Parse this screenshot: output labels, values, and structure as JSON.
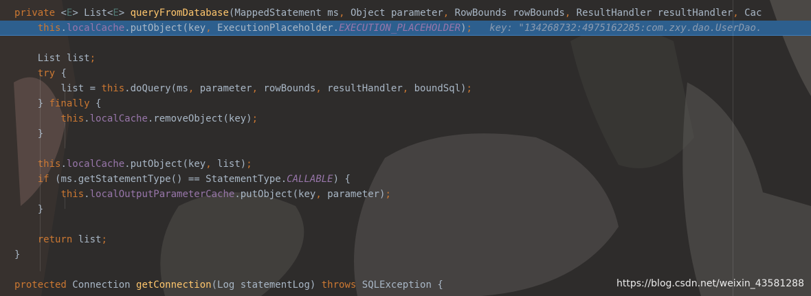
{
  "editor": {
    "lines": [
      {
        "parts": [
          [
            "kw",
            "private "
          ],
          [
            "",
            "<"
          ],
          [
            "gen",
            "E"
          ],
          [
            "",
            "> List<"
          ],
          [
            "gen",
            "E"
          ],
          [
            "",
            "> "
          ],
          [
            "fn",
            "queryFromDatabase"
          ],
          [
            "",
            "(MappedStatement ms"
          ],
          [
            "kw",
            ", "
          ],
          [
            "",
            "Object parameter"
          ],
          [
            "kw",
            ", "
          ],
          [
            "",
            "RowBounds rowBounds"
          ],
          [
            "kw",
            ", "
          ],
          [
            "",
            "ResultHandler resultHandler"
          ],
          [
            "kw",
            ", "
          ],
          [
            "",
            "Cac"
          ]
        ]
      },
      {
        "parts": [
          [
            "",
            "    "
          ],
          [
            "kw",
            "this"
          ],
          [
            "",
            "."
          ],
          [
            "fld",
            "localCache"
          ],
          [
            "",
            ".putObject(key"
          ],
          [
            "kw",
            ", "
          ],
          [
            "",
            "ExecutionPlaceholder."
          ],
          [
            "ital",
            "EXECUTION_PLACEHOLDER"
          ],
          [
            "",
            ")"
          ],
          [
            "kw",
            ";"
          ],
          [
            "",
            "   "
          ],
          [
            "hint",
            "key: \"134268732:4975162285:com.zxy.dao.UserDao."
          ]
        ]
      },
      {
        "parts": [
          [
            "",
            ""
          ]
        ]
      },
      {
        "parts": [
          [
            "",
            "    List list"
          ],
          [
            "kw",
            ";"
          ]
        ]
      },
      {
        "parts": [
          [
            "",
            "    "
          ],
          [
            "kw",
            "try "
          ],
          [
            "",
            "{"
          ]
        ]
      },
      {
        "parts": [
          [
            "",
            "        list = "
          ],
          [
            "kw",
            "this"
          ],
          [
            "",
            ".doQuery(ms"
          ],
          [
            "kw",
            ", "
          ],
          [
            "",
            "parameter"
          ],
          [
            "kw",
            ", "
          ],
          [
            "",
            "rowBounds"
          ],
          [
            "kw",
            ", "
          ],
          [
            "",
            "resultHandler"
          ],
          [
            "kw",
            ", "
          ],
          [
            "",
            "boundSql)"
          ],
          [
            "kw",
            ";"
          ]
        ]
      },
      {
        "parts": [
          [
            "",
            "    } "
          ],
          [
            "kw",
            "finally "
          ],
          [
            "",
            "{"
          ]
        ]
      },
      {
        "parts": [
          [
            "",
            "        "
          ],
          [
            "kw",
            "this"
          ],
          [
            "",
            "."
          ],
          [
            "fld",
            "localCache"
          ],
          [
            "",
            ".removeObject(key)"
          ],
          [
            "kw",
            ";"
          ]
        ]
      },
      {
        "parts": [
          [
            "",
            "    }"
          ]
        ]
      },
      {
        "parts": [
          [
            "",
            ""
          ]
        ]
      },
      {
        "parts": [
          [
            "",
            "    "
          ],
          [
            "kw",
            "this"
          ],
          [
            "",
            "."
          ],
          [
            "fld",
            "localCache"
          ],
          [
            "",
            ".putObject(key"
          ],
          [
            "kw",
            ", "
          ],
          [
            "",
            "list)"
          ],
          [
            "kw",
            ";"
          ]
        ]
      },
      {
        "parts": [
          [
            "",
            "    "
          ],
          [
            "kw",
            "if "
          ],
          [
            "",
            "(ms.getStatementType() == StatementType."
          ],
          [
            "ital",
            "CALLABLE"
          ],
          [
            "",
            ") {"
          ]
        ]
      },
      {
        "parts": [
          [
            "",
            "        "
          ],
          [
            "kw",
            "this"
          ],
          [
            "",
            "."
          ],
          [
            "fld",
            "localOutputParameterCache"
          ],
          [
            "",
            ".putObject(key"
          ],
          [
            "kw",
            ", "
          ],
          [
            "",
            "parameter)"
          ],
          [
            "kw",
            ";"
          ]
        ]
      },
      {
        "parts": [
          [
            "",
            "    }"
          ]
        ]
      },
      {
        "parts": [
          [
            "",
            ""
          ]
        ]
      },
      {
        "parts": [
          [
            "",
            "    "
          ],
          [
            "kw",
            "return "
          ],
          [
            "",
            "list"
          ],
          [
            "kw",
            ";"
          ]
        ]
      },
      {
        "parts": [
          [
            "",
            "}"
          ]
        ]
      },
      {
        "parts": [
          [
            "",
            ""
          ]
        ]
      },
      {
        "parts": [
          [
            "kw",
            "protected "
          ],
          [
            "",
            "Connection "
          ],
          [
            "fn",
            "getConnection"
          ],
          [
            "",
            "(Log statementLog) "
          ],
          [
            "kw",
            "throws "
          ],
          [
            "",
            "SQLException {"
          ]
        ]
      }
    ],
    "highlighted_line": 1
  },
  "watermark": "https://blog.csdn.net/weixin_43581288",
  "colors": {
    "keyword": "#cc7832",
    "method": "#ffc66d",
    "field": "#9876aa",
    "text": "#a9b7c6",
    "selection": "#2d5f8e"
  }
}
